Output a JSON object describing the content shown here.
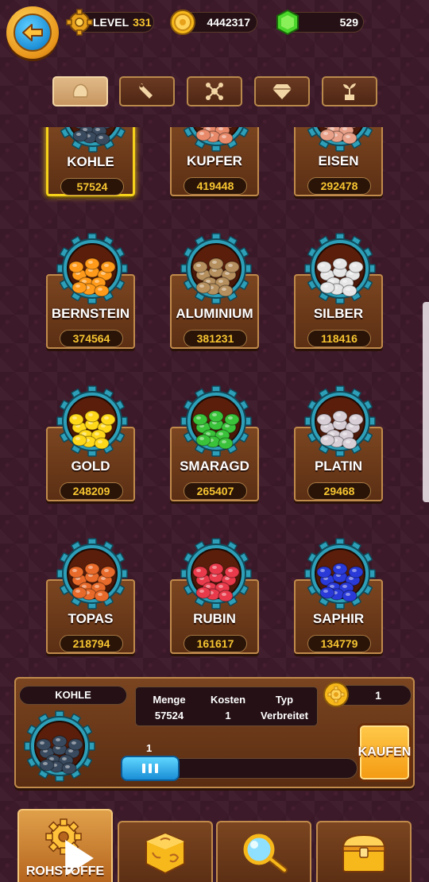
{
  "header": {
    "level_label": "LEVEL",
    "level_value": "331",
    "coins": "4442317",
    "gems": "529"
  },
  "tabs": [
    {
      "icon": "rock-icon",
      "active": true
    },
    {
      "icon": "wrench-icon",
      "active": false
    },
    {
      "icon": "molecule-icon",
      "active": false
    },
    {
      "icon": "diamond-icon",
      "active": false
    },
    {
      "icon": "sprout-icon",
      "active": false
    }
  ],
  "resources": [
    {
      "name": "KOHLE",
      "count": "57524",
      "color": "#3a4a5e",
      "selected": true
    },
    {
      "name": "KUPFER",
      "count": "419448",
      "color": "#e88a6a"
    },
    {
      "name": "EISEN",
      "count": "292478",
      "color": "#e8a088"
    },
    {
      "name": "BERNSTEIN",
      "count": "374564",
      "color": "#ff9a1a"
    },
    {
      "name": "ALUMINIUM",
      "count": "381231",
      "color": "#b58f5e"
    },
    {
      "name": "SILBER",
      "count": "118416",
      "color": "#e6e6e6"
    },
    {
      "name": "GOLD",
      "count": "248209",
      "color": "#ffd81a"
    },
    {
      "name": "SMARAGD",
      "count": "265407",
      "color": "#3ac23a"
    },
    {
      "name": "PLATIN",
      "count": "29468",
      "color": "#d8cfd6"
    },
    {
      "name": "TOPAS",
      "count": "218794",
      "color": "#e86a2a"
    },
    {
      "name": "RUBIN",
      "count": "161617",
      "color": "#e83a4a"
    },
    {
      "name": "SAPHIR",
      "count": "134779",
      "color": "#2a3ad8"
    }
  ],
  "panel": {
    "name": "KOHLE",
    "headers": {
      "amount": "Menge",
      "cost": "Kosten",
      "type": "Typ"
    },
    "values": {
      "amount": "57524",
      "cost": "1",
      "type": "Verbreitet"
    },
    "buy_quantity": "1",
    "slider_value": "1",
    "slider_fraction": 0.05,
    "buy_label": "KAUFEN"
  },
  "bottom_nav": [
    {
      "label": "ROHSTOFFE",
      "icon": "gear-icon",
      "active": true
    },
    {
      "icon": "dice-icon"
    },
    {
      "icon": "magnifier-icon"
    },
    {
      "icon": "treasure-chest-icon"
    }
  ]
}
